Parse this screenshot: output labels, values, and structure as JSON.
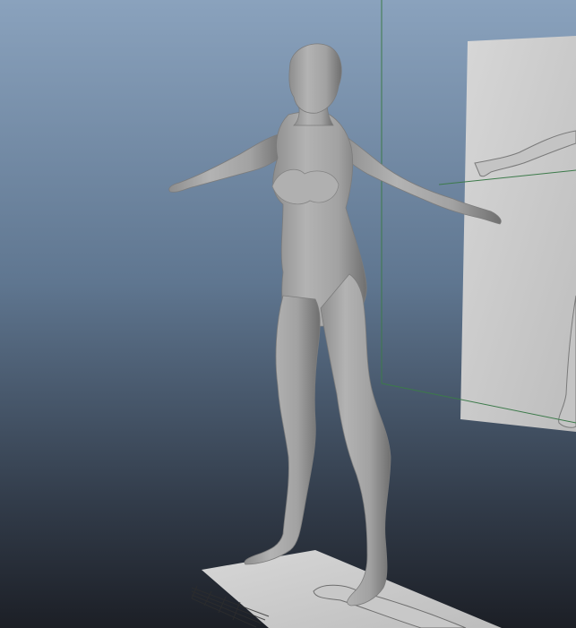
{
  "viewport": {
    "background_top": "#8aa2bd",
    "background_bottom": "#1c1f26",
    "grid_axis_color": "#3c7a4a",
    "image_plane_color": "#cfcfcf",
    "floor_plane_color": "#d4d4d4",
    "model_color": "#a9a9a9"
  }
}
